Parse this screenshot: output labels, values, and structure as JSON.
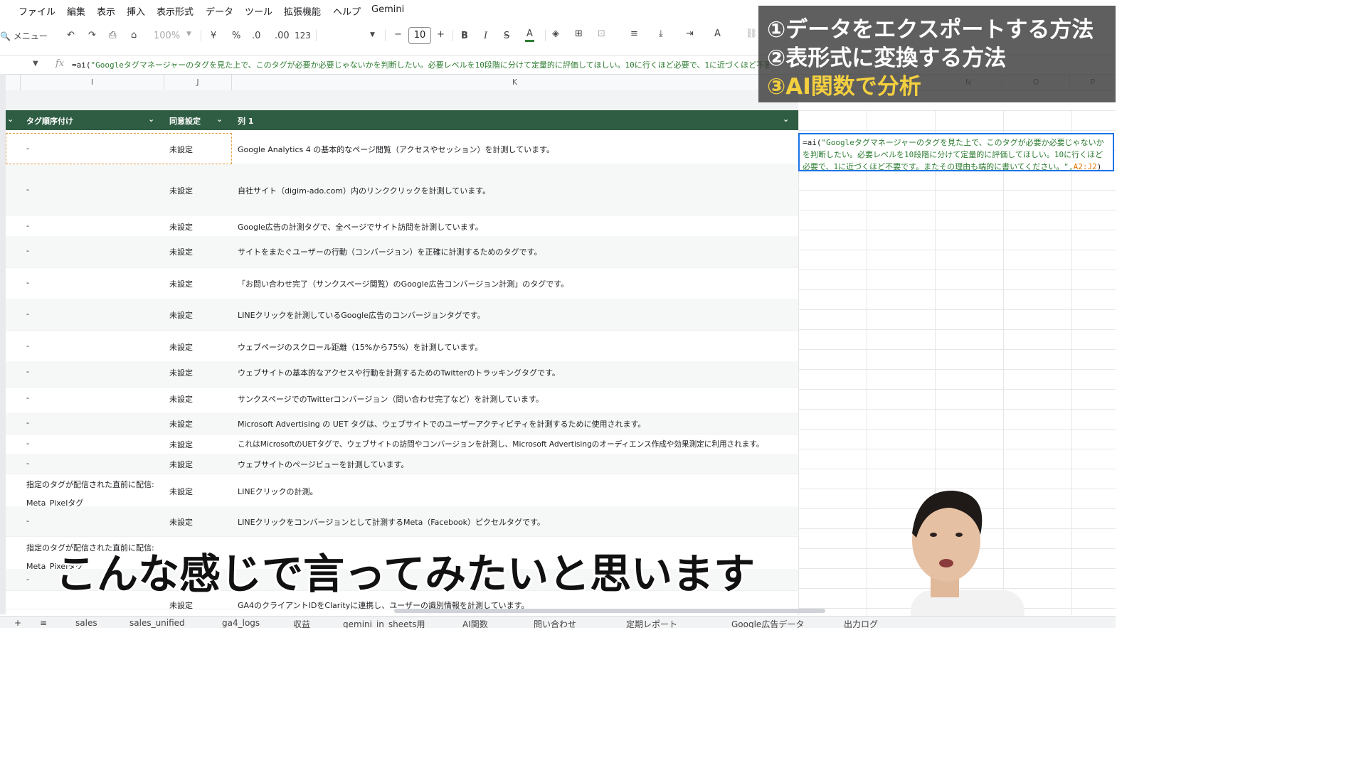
{
  "menu": [
    "ファイル",
    "編集",
    "表示",
    "挿入",
    "表示形式",
    "データ",
    "ツール",
    "拡張機能",
    "ヘルプ",
    "Gemini"
  ],
  "toolbar": {
    "search_label": "メニュー",
    "zoom": "100%",
    "currency": "¥",
    "percent": "%",
    "dec_decrease": ".0",
    "dec_increase": ".00",
    "number_format": "123",
    "font_size": "10",
    "bold": "B",
    "italic": "I",
    "strike": "S",
    "text_color": "A"
  },
  "formula": {
    "fn": "=ai(",
    "text": "\"Googleタグマネージャーのタグを見た上で、このタグが必要か必要じゃないかを判断したい。必要レベルを10段階に分けて定量的に評価してほしい。10に行くほど必要で、1に近づくほど不要です。またその理由も端的に書いてください。\",A2:J2)"
  },
  "columns": [
    "I",
    "J",
    "K",
    "N",
    "O",
    "P"
  ],
  "table_header": {
    "col_i": "タグ順序付け",
    "col_j": "同意設定",
    "col_k": "列 1"
  },
  "rows": [
    {
      "i": "-",
      "j": "未設定",
      "k": "Google Analytics 4 の基本的なページ閲覧（アクセスやセッション）を計測しています。"
    },
    {
      "i": "-",
      "j": "未設定",
      "k": "自社サイト（digim-ado.com）内のリンククリックを計測しています。"
    },
    {
      "i": "-",
      "j": "未設定",
      "k": "Google広告の計測タグで、全ページでサイト訪問を計測しています。"
    },
    {
      "i": "-",
      "j": "未設定",
      "k": "サイトをまたぐユーザーの行動（コンバージョン）を正確に計測するためのタグです。"
    },
    {
      "i": "-",
      "j": "未設定",
      "k": "「お問い合わせ完了（サンクスページ閲覧）のGoogle広告コンバージョン計測」のタグです。"
    },
    {
      "i": "-",
      "j": "未設定",
      "k": "LINEクリックを計測しているGoogle広告のコンバージョンタグです。"
    },
    {
      "i": "-",
      "j": "未設定",
      "k": "ウェブページのスクロール距離（15%から75%）を計測しています。"
    },
    {
      "i": "-",
      "j": "未設定",
      "k": "ウェブサイトの基本的なアクセスや行動を計測するためのTwitterのトラッキングタグです。"
    },
    {
      "i": "-",
      "j": "未設定",
      "k": "サンクスページでのTwitterコンバージョン（問い合わせ完了など）を計測しています。"
    },
    {
      "i": "-",
      "j": "未設定",
      "k": "Microsoft Advertising の UET タグは、ウェブサイトでのユーザーアクティビティを計測するために使用されます。"
    },
    {
      "i": "-",
      "j": "未設定",
      "k": "これはMicrosoftのUETタグで、ウェブサイトの訪問やコンバージョンを計測し、Microsoft Advertisingのオーディエンス作成や効果測定に利用されます。"
    },
    {
      "i": "-",
      "j": "未設定",
      "k": "ウェブサイトのページビューを計測しています。"
    },
    {
      "i": "指定のタグが配信された直前に配信: Meta_Pixelタグ",
      "j": "未設定",
      "k": "LINEクリックの計測。"
    },
    {
      "i": "-",
      "j": "未設定",
      "k": "LINEクリックをコンバージョンとして計測するMeta（Facebook）ピクセルタグです。"
    },
    {
      "i": "指定のタグが配信された直前に配信: Meta_Pixelタグ",
      "j": "",
      "k": ""
    },
    {
      "i": "-",
      "j": "",
      "k": ""
    },
    {
      "i": "",
      "j": "未設定",
      "k": "GA4のクライアントIDをClarityに連携し、ユーザーの識別情報を計測しています。"
    }
  ],
  "ai_cell": {
    "fn": "=ai(",
    "text": "\"Googleタグマネージャーのタグを見た上で、このタグが必要か必要じゃないかを判断したい。必要レベルを10段階に分けて定量的に評価してほしい。10に行くほど必要で、1に近づくほど不要です。またその理由も端的に書いてください。\",",
    "range": "A2:J2",
    "close": ")",
    "badge": "?"
  },
  "overlay": {
    "line1": "①データをエクスポートする方法",
    "line2": "②表形式に変換する方法",
    "line3": "③AI関数で分析"
  },
  "subtitle": "こんな感じで言ってみたいと思います",
  "sheet_tabs": [
    "+",
    "≡",
    "sales",
    "sales_unified",
    "ga4_logs",
    "収益",
    "gemini_in_sheets用",
    "AI関数",
    "問い合わせ",
    "定期レポート",
    "Google広告データ",
    "出力ログ"
  ],
  "colors": {
    "header_green": "#2f5d43",
    "formula_green": "#2e7d32",
    "selection_blue": "#1a73e8",
    "overlay_highlight": "#f4d03f"
  }
}
